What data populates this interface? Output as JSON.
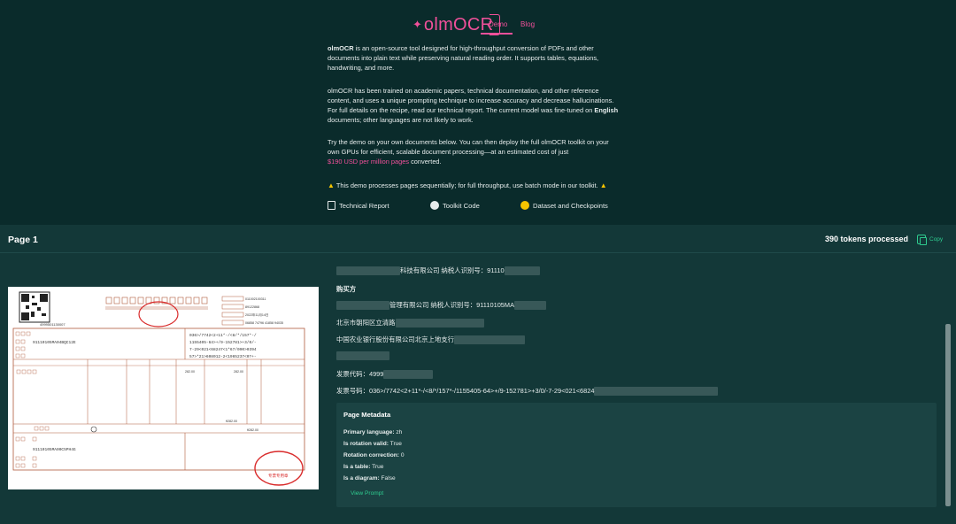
{
  "header": {
    "brand": "olmOCR",
    "nav": [
      {
        "label": "Demo",
        "active": true
      },
      {
        "label": "Blog",
        "active": false
      }
    ]
  },
  "intro": {
    "p1_bold": "olmOCR",
    "p1_line1_rest": " is an open-source tool designed for high-throughput conversion of PDFs and other",
    "p1_line2": "documents into plain text while preserving natural reading order. It supports tables, equations,",
    "p1_line3": "handwriting, and more.",
    "p2_line1": "olmOCR has been trained on academic papers, technical documentation, and other reference",
    "p2_line2": "content, and uses a unique prompting technique to increase accuracy and decrease hallucinations.",
    "p2_line3": "For full details on the recipe, read our technical report. The current model was fine-tuned on",
    "p2_line3_bold": "English",
    "p2_line4": "documents; other languages are not likely to work.",
    "p3_line1": "Try the demo on your own documents below. You can then deploy the full olmOCR toolkit on your",
    "p3_line2": "own GPUs for efficient, scalable document processing—at an estimated cost of just",
    "p3_price": "$190 USD per million pages",
    "p3_tail": " converted.",
    "warning": "This demo processes pages sequentially; for full throughput, use batch mode in our toolkit."
  },
  "links": [
    {
      "label": "Technical Report",
      "icon": "document-icon"
    },
    {
      "label": "Toolkit Code",
      "icon": "github-icon"
    },
    {
      "label": "Dataset and Checkpoints",
      "icon": "huggingface-icon"
    }
  ],
  "page": {
    "title": "Page 1",
    "tokens": "390 tokens processed",
    "copy_label": "Copy"
  },
  "output": {
    "l1": "科技有限公司 纳税人识别号：91110",
    "buyer_heading": "购买方",
    "l2": "管理有限公司 纳税人识别号：91110105MA",
    "l3": "北京市朝阳区立清路",
    "l4": "中国农业银行股份有限公司北京上地支行",
    "l5": "发票代码：4999",
    "l6": "发票号码：036>/7742<2+11*-/<8/*/157*-/1155405-64>+/9-152781>+3/0/-7-29<021<6824"
  },
  "metadata": {
    "title": "Page Metadata",
    "rows": [
      {
        "key": "Primary language:",
        "value": "zh"
      },
      {
        "key": "Is rotation valid:",
        "value": "True"
      },
      {
        "key": "Rotation correction:",
        "value": "0"
      },
      {
        "key": "Is a table:",
        "value": "True"
      },
      {
        "key": "Is a diagram:",
        "value": "False"
      }
    ],
    "view_prompt": "View Prompt"
  },
  "invoice": {
    "tax_id_1": "91110105MA04BQC12E",
    "tax_id_2": "91110105MA00C5PH4G",
    "code_block": "036>/7742<2+11*-/<8/*/157*-/",
    "code_block2": "1155405-64>+/9-152781>+3/0/-",
    "code_block3": "7-29<021<68247<1*67/090>0394",
    "code_block4": "57>*21>608012-2<1965237<0?+-",
    "amount1": "282.00",
    "amount2": "282.00",
    "total": "¥282.00",
    "seal_text": "专票专用章",
    "top_right_1": "011002100311",
    "top_right_2": "89122868",
    "top_right_3": "2022年11月14日",
    "top_right_4": "06858 74796 41858 94035",
    "invoice_no": "4999501130007"
  },
  "colors": {
    "bg": "#0a2b2b",
    "panel": "#133838",
    "accent_pink": "#f0509a",
    "accent_green": "#2ecc8f",
    "warn_yellow": "#f5c400"
  }
}
